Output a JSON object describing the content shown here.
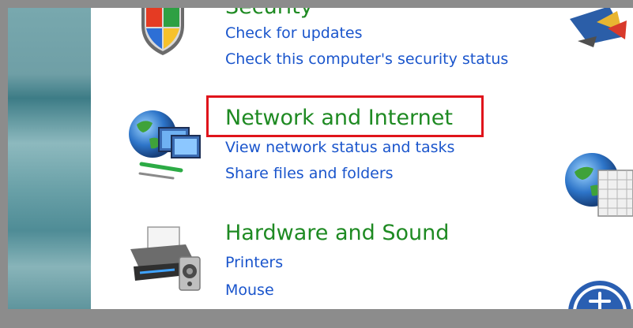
{
  "categories": {
    "security": {
      "title": "Security",
      "links": [
        "Check for updates",
        "Check this computer's security status"
      ]
    },
    "network": {
      "title": "Network and Internet",
      "links": [
        "View network status and tasks",
        "Share files and folders"
      ]
    },
    "hardware": {
      "title": "Hardware and Sound",
      "links": [
        "Printers",
        "Mouse"
      ]
    }
  },
  "colors": {
    "category_title": "#1e8a22",
    "link": "#1a55cc",
    "highlight": "#e0141b",
    "frame": "#8c8c8c"
  },
  "icons": {
    "security": "shield-icon",
    "network": "network-globe-icon",
    "hardware": "printer-speaker-icon",
    "right_top": "display-icon",
    "right_middle": "globe-calendar-icon",
    "right_bottom": "ease-of-access-icon"
  }
}
